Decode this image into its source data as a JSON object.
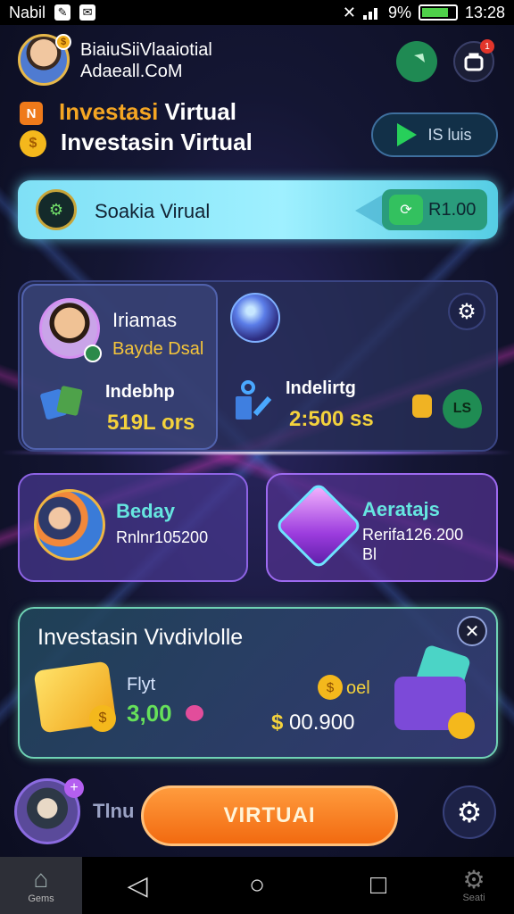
{
  "status_bar": {
    "carrier": "Nabil",
    "battery_text": "9%",
    "time": "13:28"
  },
  "header": {
    "title_line1": "BiaiuSiiVlaaiotial",
    "title_line2": "Adaeall.CoM",
    "notification_count": "1"
  },
  "intro": {
    "line1_prefix": "Investasi",
    "line1_suffix": "Virtual",
    "line2": "Investasin Virtual",
    "play_label": "IS luis"
  },
  "banner": {
    "label": "Soakia Virual",
    "value": "R1.00"
  },
  "profile_card": {
    "name": "Iriamas",
    "subtitle": "Bayde Dsal",
    "stat1_label": "Indebhp",
    "stat1_value": "519L ors",
    "stat2_label": "Indelirtg",
    "stat2_value": "2:500 ss",
    "badge_text": "LS"
  },
  "mid_left": {
    "title": "Beday",
    "subtitle": "Rnlnr105200"
  },
  "mid_right": {
    "title": "Aeratajs",
    "subtitle1": "Rerifa126.200",
    "subtitle2": "Bl"
  },
  "offer_card": {
    "title": "Investasin Vivdivlolle",
    "label1": "Flyt",
    "value1": "3,00",
    "label2": "oel",
    "value2_symbol": "$",
    "value2": "00.900"
  },
  "bottom": {
    "side_label": "Tlnu",
    "cta_label": "VIRTUAI"
  },
  "nav": {
    "home_label": "Gems",
    "settings_label": "Seati"
  },
  "colors": {
    "accent_orange": "#f5a623",
    "cta": "#f26a10",
    "banner": "#7fe0f6",
    "gold": "#f4d23c"
  }
}
